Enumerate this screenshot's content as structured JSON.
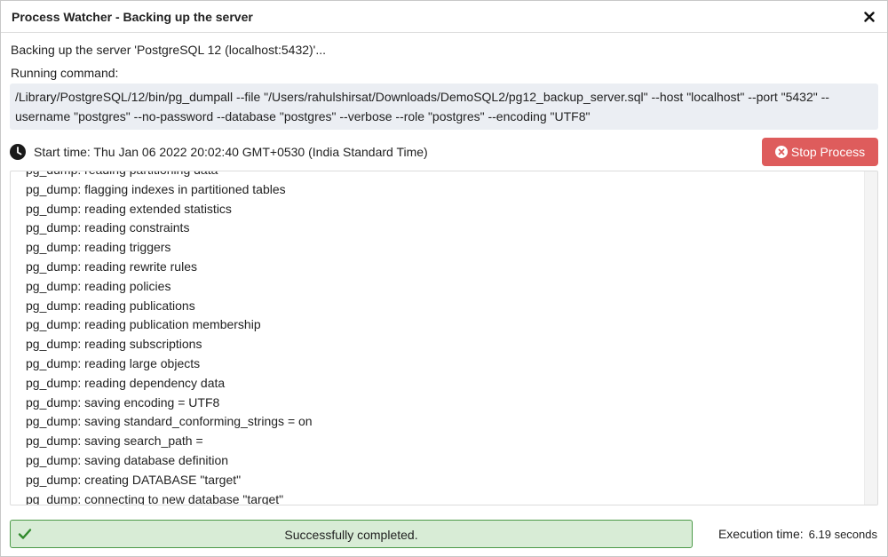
{
  "header": {
    "title": "Process Watcher - Backing up the server"
  },
  "description": "Backing up the server 'PostgreSQL 12 (localhost:5432)'...",
  "command": {
    "label": "Running command:",
    "line1": "/Library/PostgreSQL/12/bin/pg_dumpall --file \"/Users/rahulshirsat/Downloads/DemoSQL2/pg12_backup_server.sql\" --host \"localhost\" --port \"5432\" --",
    "line2": "username \"postgres\" --no-password --database \"postgres\" --verbose --role \"postgres\" --encoding \"UTF8\""
  },
  "start_time": "Start time: Thu Jan 06 2022 20:02:40 GMT+0530 (India Standard Time)",
  "stop_button": "Stop Process",
  "log_lines": [
    "pg_dump: reading partitioning data",
    "pg_dump: flagging indexes in partitioned tables",
    "pg_dump: reading extended statistics",
    "pg_dump: reading constraints",
    "pg_dump: reading triggers",
    "pg_dump: reading rewrite rules",
    "pg_dump: reading policies",
    "pg_dump: reading publications",
    "pg_dump: reading publication membership",
    "pg_dump: reading subscriptions",
    "pg_dump: reading large objects",
    "pg_dump: reading dependency data",
    "pg_dump: saving encoding = UTF8",
    "pg_dump: saving standard_conforming_strings = on",
    "pg_dump: saving search_path = ",
    "pg_dump: saving database definition",
    "pg_dump: creating DATABASE \"target\"",
    "pg_dump: connecting to new database \"target\""
  ],
  "status": {
    "message": "Successfully completed.",
    "exec_label": "Execution time:",
    "exec_value": "6.19 seconds"
  },
  "colors": {
    "stop_button": "#de5c5c",
    "success_bg": "#d8ecd6",
    "success_border": "#4c9a48",
    "command_bg": "#ebeef3"
  }
}
